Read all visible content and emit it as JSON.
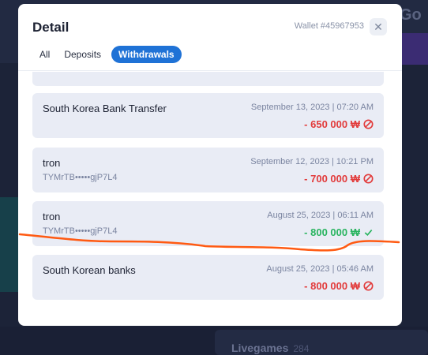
{
  "background": {
    "go_text": "Go",
    "livegames_label": "Livegames",
    "livegames_count": "284"
  },
  "modal": {
    "title": "Detail",
    "wallet": "Wallet #45967953",
    "close_icon": "✕",
    "tabs": [
      {
        "label": "All",
        "active": false
      },
      {
        "label": "Deposits",
        "active": false
      },
      {
        "label": "Withdrawals",
        "active": true
      }
    ]
  },
  "transactions": [
    {
      "name": "South Korea Bank Transfer",
      "address": "",
      "date": "September 13, 2023 | 07:20 AM",
      "amount": "- 650 000 ₩",
      "status": "rejected"
    },
    {
      "name": "tron",
      "address": "TYMrTB•••••gjP7L4",
      "date": "September 12, 2023 | 10:21 PM",
      "amount": "- 700 000 ₩",
      "status": "rejected"
    },
    {
      "name": "tron",
      "address": "TYMrTB•••••gjP7L4",
      "date": "August 25, 2023 | 06:11 AM",
      "amount": "- 800 000 ₩",
      "status": "success"
    },
    {
      "name": "South Korean banks",
      "address": "",
      "date": "August 25, 2023 | 05:46 AM",
      "amount": "- 800 000 ₩",
      "status": "rejected"
    }
  ],
  "colors": {
    "negative": "#e23b3b",
    "positive": "#29b45f",
    "accent": "#1f72d6",
    "annotation_line": "#ff5a12"
  },
  "icons": {
    "rejected": "prohibited-icon",
    "success": "checkmark-icon"
  }
}
